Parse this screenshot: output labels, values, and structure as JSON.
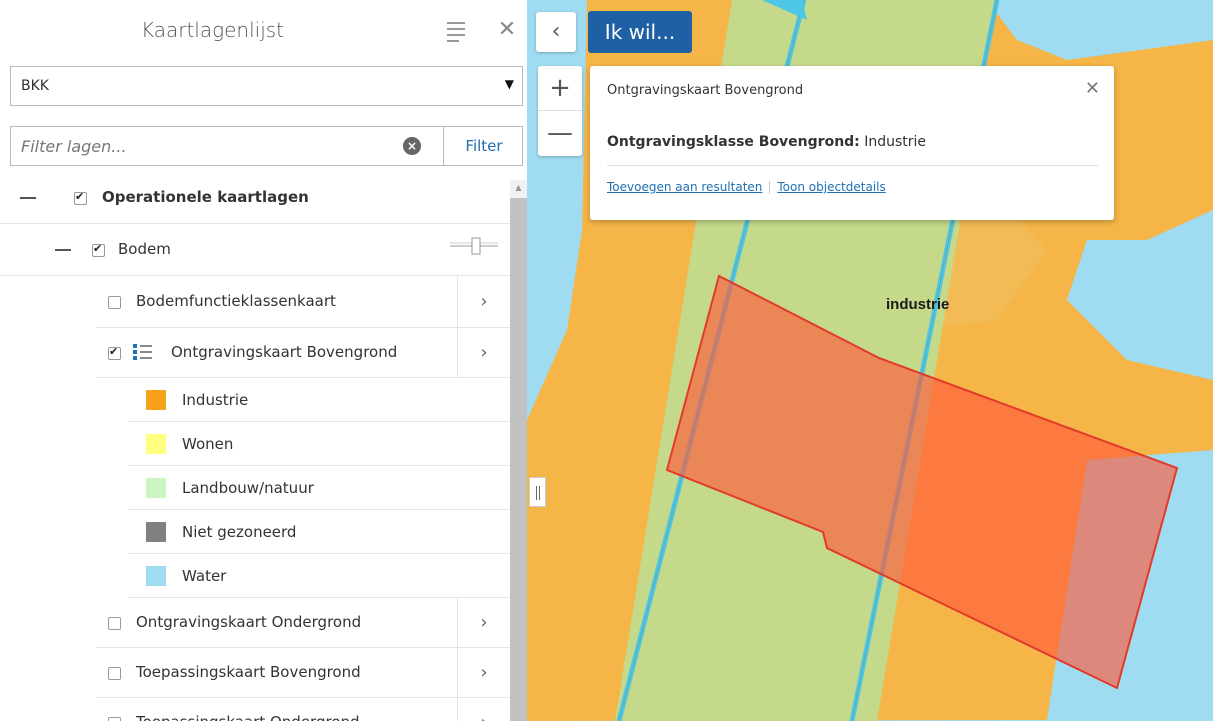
{
  "panel": {
    "title": "Kaartlagenlijst",
    "select_value": "BKK",
    "filter_placeholder": "Filter lagen...",
    "filter_button": "Filter"
  },
  "tree": {
    "group_label": "Operationele kaartlagen",
    "subgroup_label": "Bodem",
    "layers": [
      {
        "label": "Bodemfunctieklassenkaart",
        "checked": false
      },
      {
        "label": "Ontgravingskaart Bovengrond",
        "checked": true
      },
      {
        "label": "Ontgravingskaart Ondergrond",
        "checked": false
      },
      {
        "label": "Toepassingskaart Bovengrond",
        "checked": false
      },
      {
        "label": "Toepassingskaart Ondergrond",
        "checked": false
      }
    ],
    "legend": [
      {
        "label": "Industrie",
        "color": "#f5a21a"
      },
      {
        "label": "Wonen",
        "color": "#ffff80"
      },
      {
        "label": "Landbouw/natuur",
        "color": "#cdf5c0"
      },
      {
        "label": "Niet gezoneerd",
        "color": "#808080"
      },
      {
        "label": "Water",
        "color": "#9fdcf2"
      }
    ]
  },
  "map": {
    "ik_wil_label": "Ik wil...",
    "collapse_icon": "‹",
    "zoom_in": "+",
    "zoom_out": "—",
    "feature_label": "industrie",
    "colors": {
      "industrie": "#f5b547",
      "landbouw": "#c5d98a",
      "water": "#9fdcf2",
      "selection": "#ff5a3c"
    }
  },
  "popup": {
    "title": "Ontgravingskaart Bovengrond",
    "field_name": "Ontgravingsklasse Bovengrond:",
    "field_value": "Industrie",
    "link_add": "Toevoegen aan resultaten",
    "link_details": "Toon objectdetails"
  }
}
